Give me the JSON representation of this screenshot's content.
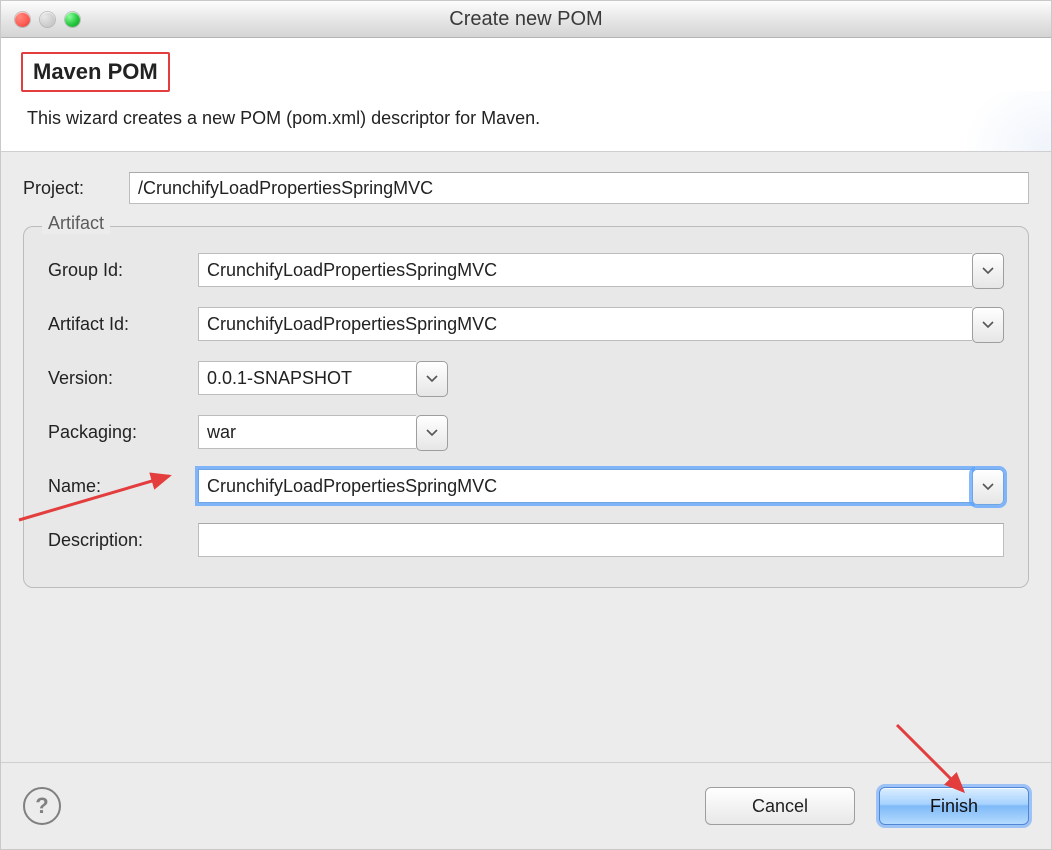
{
  "window": {
    "title": "Create new POM"
  },
  "banner": {
    "heading": "Maven POM",
    "subtext": "This wizard creates a new POM (pom.xml) descriptor for Maven."
  },
  "project": {
    "label": "Project:",
    "value": "/CrunchifyLoadPropertiesSpringMVC"
  },
  "artifact": {
    "legend": "Artifact",
    "groupId": {
      "label": "Group Id:",
      "value": "CrunchifyLoadPropertiesSpringMVC"
    },
    "artifactId": {
      "label": "Artifact Id:",
      "value": "CrunchifyLoadPropertiesSpringMVC"
    },
    "version": {
      "label": "Version:",
      "value": "0.0.1-SNAPSHOT"
    },
    "packaging": {
      "label": "Packaging:",
      "value": "war"
    },
    "name": {
      "label": "Name:",
      "value": "CrunchifyLoadPropertiesSpringMVC"
    },
    "description": {
      "label": "Description:",
      "value": ""
    }
  },
  "footer": {
    "cancel": "Cancel",
    "finish": "Finish"
  }
}
